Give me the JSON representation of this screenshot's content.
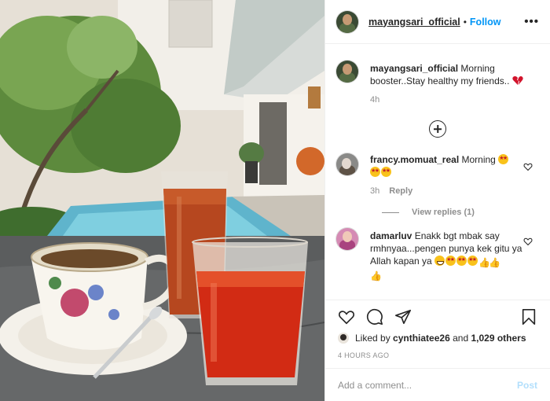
{
  "post": {
    "author": "mayangsari_official",
    "separator": "•",
    "follow_label": "Follow",
    "more_label": "•••",
    "photo_alt": "photo"
  },
  "caption": {
    "username": "mayangsari_official",
    "text": "Morning booster..Stay healthy my friends..",
    "time": "4h"
  },
  "comments": [
    {
      "username": "francy.momuat_real",
      "text": "Morning",
      "time": "3h",
      "reply_label": "Reply",
      "view_replies": "View replies (1)"
    },
    {
      "username": "damarluv",
      "text": "Enakk bgt mbak say rmhnyaa...pengen punya kek gitu ya Allah kapan ya"
    }
  ],
  "likes": {
    "prefix": "Liked by",
    "user": "cynthiatee26",
    "conj": "and",
    "others": "1,029 others"
  },
  "timestamp": "4 HOURS AGO",
  "comment_box": {
    "placeholder": "Add a comment...",
    "post_label": "Post"
  },
  "colors": {
    "link": "#0095f6",
    "post_disabled": "#b2dffc",
    "muted": "#8e8e8e"
  }
}
